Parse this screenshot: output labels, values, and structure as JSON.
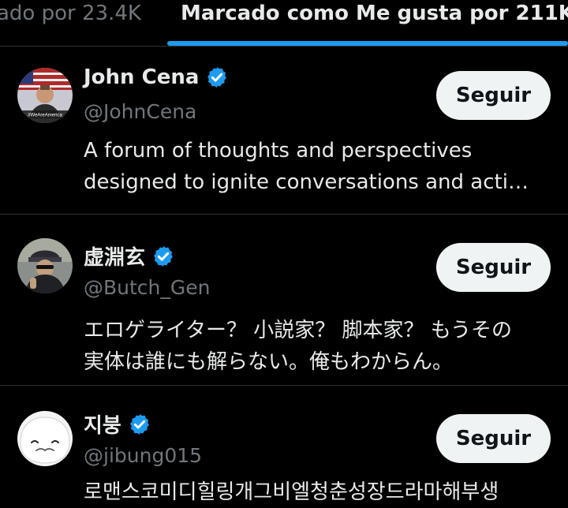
{
  "tabs": {
    "left_label": "ado por 23.4K",
    "active_label": "Marcado como Me gusta por 211K"
  },
  "accent_color": "#1d9bf0",
  "users": [
    {
      "name": "John Cena",
      "handle": "@JohnCena",
      "verified": true,
      "avatar_caption": "#WeAreAmerica",
      "bio_line1": "A forum of thoughts and perspectives",
      "bio_line2": "designed to ignite conversations and acti…",
      "follow_label": "Seguir"
    },
    {
      "name": "虚淵玄",
      "handle": "@Butch_Gen",
      "verified": true,
      "bio_line1": "エロゲライター？ 小説家？ 脚本家？ もうその",
      "bio_line2": "実体は誰にも解らない。俺もわからん。",
      "follow_label": "Seguir"
    },
    {
      "name": "지붕",
      "handle": "@jibung015",
      "verified": true,
      "bio_line1": "로맨스코미디힐링개그비엘청춘성장드라마해부생",
      "follow_label": "Seguir"
    }
  ]
}
